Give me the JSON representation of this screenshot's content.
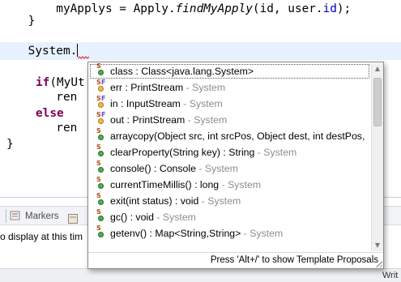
{
  "editor": {
    "line1": {
      "prefix": "        myApplys = Apply.",
      "method": "findMyApply",
      "args_open": "(id, user.",
      "field": "id",
      "suffix": ");"
    },
    "line2": "    }",
    "line3": "    System.",
    "line4": {
      "keyword": "if",
      "text": "(MyUt"
    },
    "line5": "        ren",
    "line6": "else",
    "line7": "        ren",
    "line8": "}"
  },
  "views": {
    "markers_label": "Markers",
    "message": "o display at this tim",
    "partial_label": "Writ"
  },
  "content_assist": {
    "items": [
      {
        "kind": "class",
        "modifier": "S",
        "label": "class : Class<java.lang.System>",
        "owner": ""
      },
      {
        "kind": "field",
        "modifier": "SF",
        "label": "err : PrintStream",
        "owner": " - System"
      },
      {
        "kind": "field",
        "modifier": "SF",
        "label": "in : InputStream",
        "owner": " - System"
      },
      {
        "kind": "field",
        "modifier": "SF",
        "label": "out : PrintStream",
        "owner": " - System"
      },
      {
        "kind": "method",
        "modifier": "S",
        "label": "arraycopy(Object src, int srcPos, Object dest, int destPos,",
        "owner": ""
      },
      {
        "kind": "method",
        "modifier": "S",
        "label": "clearProperty(String key) : String",
        "owner": " - System"
      },
      {
        "kind": "method",
        "modifier": "S",
        "label": "console() : Console",
        "owner": " - System"
      },
      {
        "kind": "method",
        "modifier": "S",
        "label": "currentTimeMillis() : long",
        "owner": " - System"
      },
      {
        "kind": "method",
        "modifier": "S",
        "label": "exit(int status) : void",
        "owner": " - System"
      },
      {
        "kind": "method",
        "modifier": "S",
        "label": "gc() : void",
        "owner": " - System"
      },
      {
        "kind": "method",
        "modifier": "S",
        "label": "getenv() : Map<String,String>",
        "owner": " - System"
      }
    ],
    "footer": "Press 'Alt+/' to show Template Proposals"
  },
  "colors": {
    "keyword": "#7f0055",
    "field": "#0000c0",
    "current_line": "#e8f2fe",
    "muted": "#8c8c8c"
  }
}
